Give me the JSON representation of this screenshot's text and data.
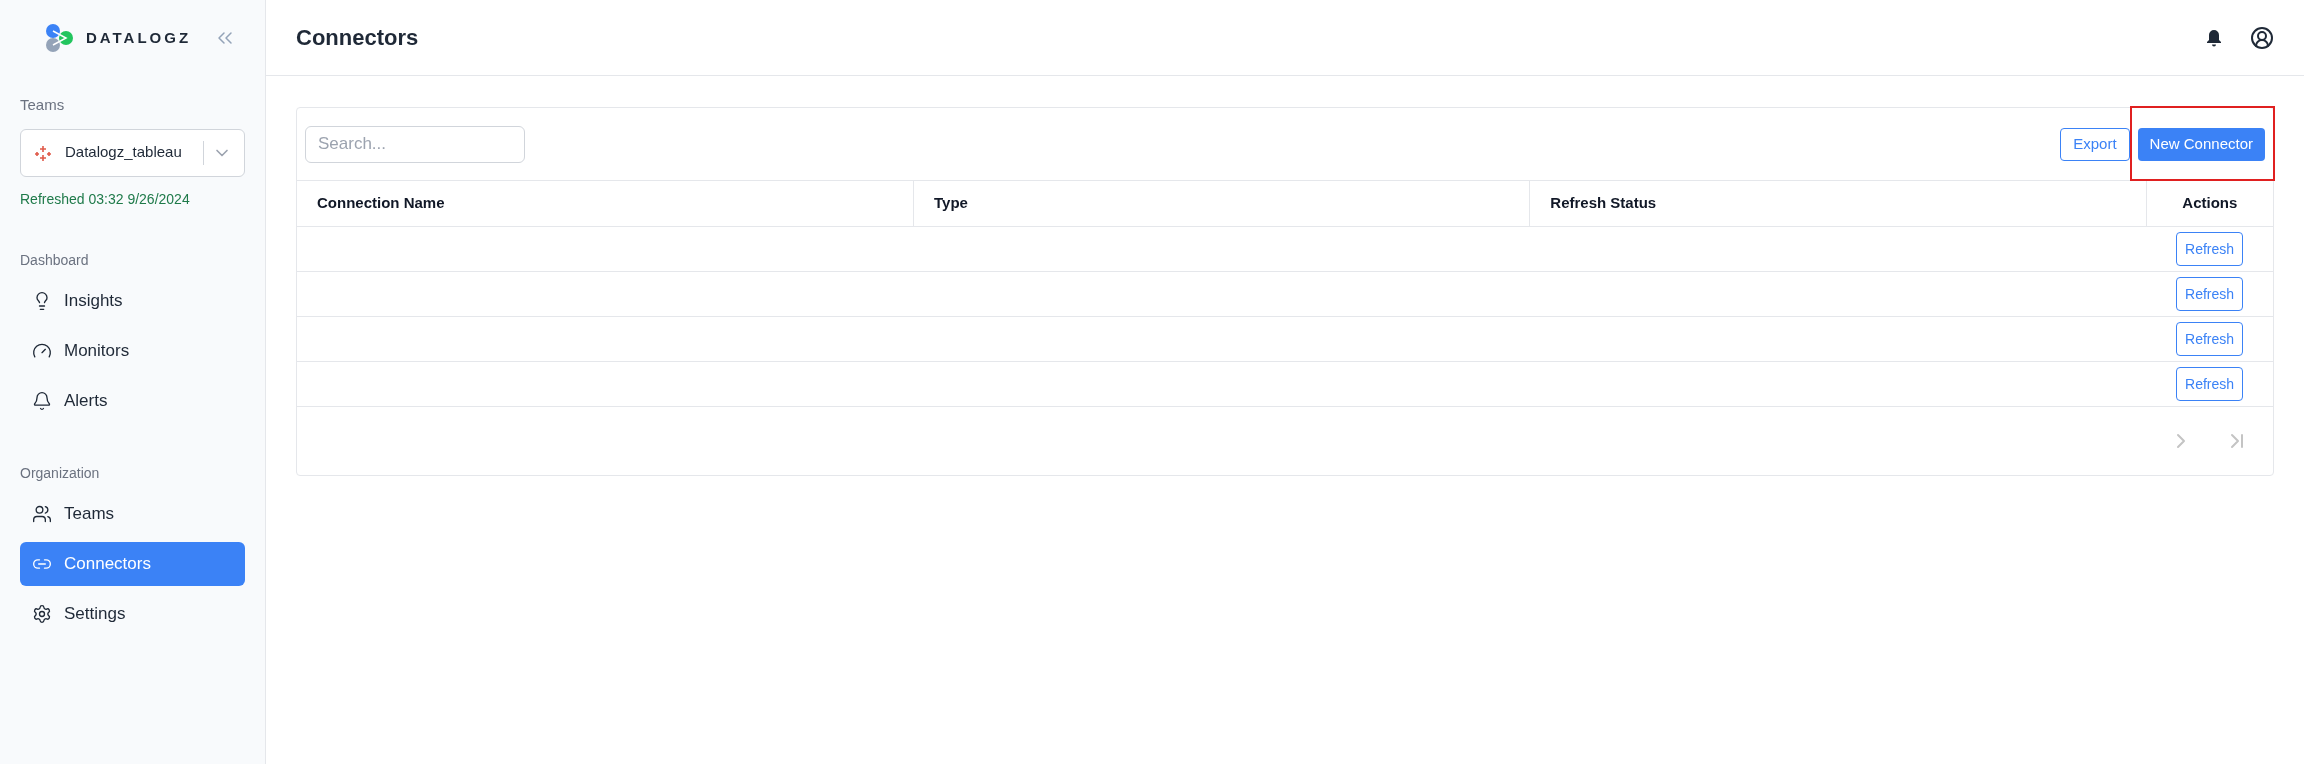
{
  "sidebar": {
    "logo": "DATALOGZ",
    "teams_label": "Teams",
    "team_select": {
      "value": "Datalogz_tableau"
    },
    "refreshed": "Refreshed 03:32 9/26/2024",
    "sections": [
      {
        "title": "Dashboard",
        "items": [
          {
            "label": "Insights",
            "kind": "bulb",
            "selected": false
          },
          {
            "label": "Monitors",
            "kind": "gauge",
            "selected": false
          },
          {
            "label": "Alerts",
            "kind": "bell",
            "selected": false
          }
        ]
      },
      {
        "title": "Organization",
        "items": [
          {
            "label": "Teams",
            "kind": "users",
            "selected": false
          },
          {
            "label": "Connectors",
            "kind": "link",
            "selected": true
          },
          {
            "label": "Settings",
            "kind": "gear",
            "selected": false
          }
        ]
      }
    ]
  },
  "header": {
    "title": "Connectors"
  },
  "toolbar": {
    "search": {
      "placeholder": "Search..."
    },
    "export": "Export",
    "new_connector": {
      "label": "New Connector",
      "highlighted": true
    }
  },
  "table": {
    "columns": [
      "Connection Name",
      "Type",
      "Refresh Status",
      "Actions"
    ],
    "rows": [
      {
        "action": "Refresh"
      },
      {
        "action": "Refresh"
      },
      {
        "action": "Refresh"
      },
      {
        "action": "Refresh"
      }
    ]
  },
  "pagination": {
    "next_disabled": true,
    "last_disabled": true
  }
}
